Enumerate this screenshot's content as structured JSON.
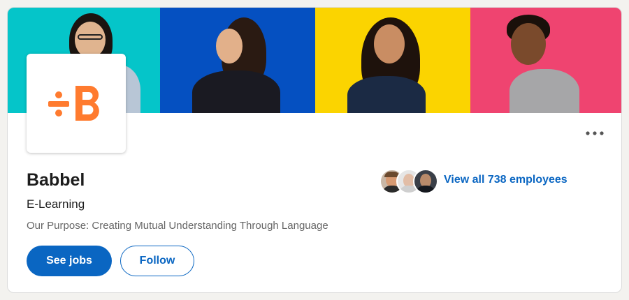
{
  "company": {
    "name": "Babbel",
    "industry": "E-Learning",
    "tagline": "Our Purpose: Creating Mutual Understanding Through Language",
    "logo_text": "÷B"
  },
  "actions": {
    "see_jobs_label": "See jobs",
    "follow_label": "Follow",
    "more_label": "•••"
  },
  "employees": {
    "link_label": "View all 738 employees"
  },
  "colors": {
    "banner_panels": [
      "#05c5c9",
      "#0550c1",
      "#fbd400",
      "#ef4470"
    ],
    "logo_orange": "#ff7b2f",
    "accent_blue": "#0a66c2"
  }
}
